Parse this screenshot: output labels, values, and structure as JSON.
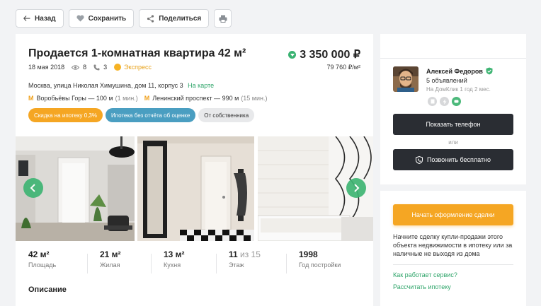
{
  "toolbar": {
    "back_label": "Назад",
    "save_label": "Сохранить",
    "share_label": "Поделиться"
  },
  "listing": {
    "title": "Продается 1-комнатная квартира 42 м²",
    "date": "18 мая 2018",
    "views": "8",
    "calls": "3",
    "express": "Экспресс",
    "price": "3 350 000 ₽",
    "price_per_m2": "79 760 ₽/м²",
    "address": "Москва, улица Николая Химушина, дом 11, корпус 3",
    "map_link": "На карте",
    "metro": [
      {
        "name": "Воробьёвы Горы — 100 м",
        "time": "(1 мин.)"
      },
      {
        "name": "Ленинский проспект — 990 м",
        "time": "(15 мин.)"
      }
    ],
    "tags": [
      "Скидка на ипотеку 0,3%",
      "Ипотека без отчёта об оценке",
      "От собственника"
    ],
    "stats": [
      {
        "value": "42 м²",
        "suffix": "",
        "label": "Площадь"
      },
      {
        "value": "21 м²",
        "suffix": "",
        "label": "Жилая"
      },
      {
        "value": "13 м²",
        "suffix": "",
        "label": "Кухня"
      },
      {
        "value": "11",
        "suffix": " из 15",
        "label": "Этаж"
      },
      {
        "value": "1998",
        "suffix": "",
        "label": "Год постройки"
      }
    ],
    "description_heading": "Описание"
  },
  "agent": {
    "name": "Алексей Федоров",
    "listings_count": "5 объявлений",
    "since": "На ДомКлик 1 год 2 мес.",
    "show_phone_label": "Показать телефон",
    "or_label": "или",
    "call_free_label": "Позвонить бесплатно"
  },
  "deal": {
    "button_label": "Начать оформление сделки",
    "text": "Начните сделку купли-продажи этого объекта недвижимости в ипотеку или за наличные не выходя из дома",
    "how_link": "Как работает сервис?",
    "calc_link": "Рассчитать ипотеку"
  },
  "colors": {
    "accent_green": "#39b271",
    "accent_orange": "#f5a623",
    "dark_button": "#2a2d33"
  }
}
